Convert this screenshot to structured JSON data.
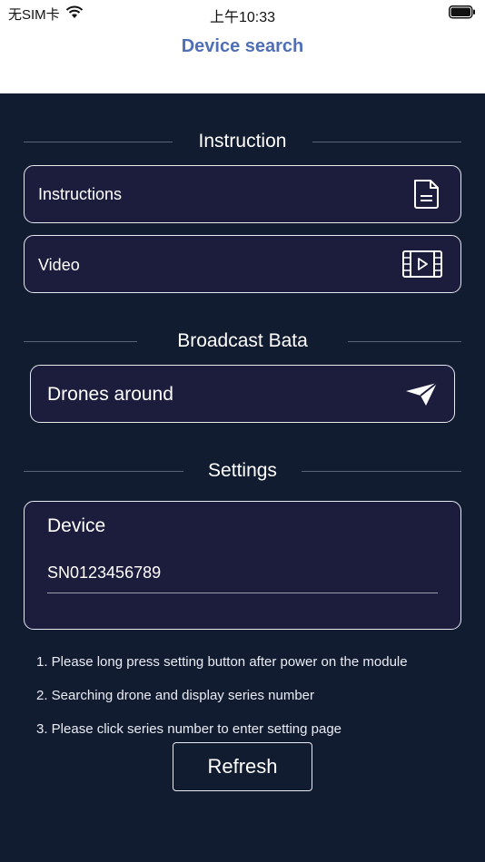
{
  "status_bar": {
    "carrier": "无SIM卡",
    "time": "上午10:33"
  },
  "nav": {
    "title": "Device search"
  },
  "instruction_section": {
    "title": "Instruction",
    "items": [
      {
        "label": "Instructions",
        "icon": "document-icon"
      },
      {
        "label": "Video",
        "icon": "video-icon"
      }
    ]
  },
  "broadcast_section": {
    "title": "Broadcast Bata",
    "item": {
      "label": "Drones around",
      "icon": "send-icon"
    }
  },
  "settings_section": {
    "title": "Settings",
    "device_label": "Device",
    "serial_value": "SN0123456789"
  },
  "steps": [
    "1. Please long press setting button after power on the module",
    "2. Searching drone and display series number",
    "3. Please click series number to enter setting page"
  ],
  "refresh_label": "Refresh",
  "colors": {
    "background": "#121c30",
    "card": "#1c1c3c",
    "title_accent": "#4f6fb6"
  }
}
